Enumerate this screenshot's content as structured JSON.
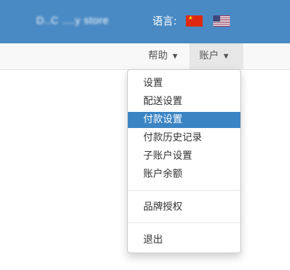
{
  "header": {
    "brand": "D..C ....y store",
    "language_label": "语言:",
    "flags": [
      "china-flag",
      "usa-flag"
    ]
  },
  "nav": {
    "help": "帮助",
    "account": "账户"
  },
  "menu": {
    "items": [
      {
        "label": "设置"
      },
      {
        "label": "配送设置"
      },
      {
        "label": "付款设置",
        "active": true
      },
      {
        "label": "付款历史记录"
      },
      {
        "label": "子账户设置"
      },
      {
        "label": "账户余额"
      },
      {
        "label": "品牌授权"
      },
      {
        "label": "退出"
      }
    ]
  },
  "colors": {
    "header_bg": "#4a8ac4",
    "active_bg": "#3b84c4",
    "navbar_bg": "#f8f8f8"
  }
}
